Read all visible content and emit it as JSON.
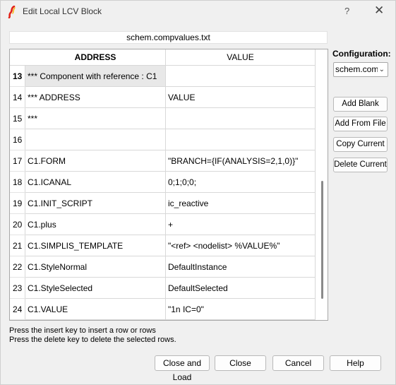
{
  "window": {
    "title": "Edit Local LCV Block",
    "help_symbol": "?",
    "close_symbol": "✕",
    "icon": "simplis-logo-icon"
  },
  "filename": "schem.compvalues.txt",
  "table": {
    "headers": {
      "address": "ADDRESS",
      "value": "VALUE"
    },
    "rows": [
      {
        "num": "13",
        "address": "*** Component with reference : C1",
        "value": ""
      },
      {
        "num": "14",
        "address": "*** ADDRESS",
        "value": "VALUE"
      },
      {
        "num": "15",
        "address": "***",
        "value": ""
      },
      {
        "num": "16",
        "address": "",
        "value": ""
      },
      {
        "num": "17",
        "address": "C1.FORM",
        "value": "\"BRANCH={IF(ANALYSIS=2,1,0)}\""
      },
      {
        "num": "18",
        "address": "C1.ICANAL",
        "value": "0;1;0;0;"
      },
      {
        "num": "19",
        "address": "C1.INIT_SCRIPT",
        "value": "ic_reactive"
      },
      {
        "num": "20",
        "address": "C1.plus",
        "value": "+"
      },
      {
        "num": "21",
        "address": "C1.SIMPLIS_TEMPLATE",
        "value": "\"<ref> <nodelist> %VALUE%\""
      },
      {
        "num": "22",
        "address": "C1.StyleNormal",
        "value": "DefaultInstance"
      },
      {
        "num": "23",
        "address": "C1.StyleSelected",
        "value": "DefaultSelected"
      },
      {
        "num": "24",
        "address": "C1.VALUE",
        "value": "\"1n IC=0\""
      }
    ]
  },
  "configuration": {
    "label": "Configuration:",
    "selected": "schem.compvalues.txt",
    "selected_visible": "schem.comp"
  },
  "buttons": {
    "add_blank": "Add Blank",
    "add_from_file": "Add From File",
    "copy_current": "Copy Current",
    "delete_current": "Delete Current",
    "close_and_load": "Close and Load",
    "close": "Close",
    "cancel": "Cancel",
    "help": "Help"
  },
  "hints": {
    "insert": "Press the insert key to insert a row or rows",
    "delete": "Press the delete key to delete the selected rows."
  },
  "colors": {
    "logo_red": "#e2231a",
    "selected_cell": "#e8e8e8",
    "window_bg": "#f0f0f0"
  }
}
